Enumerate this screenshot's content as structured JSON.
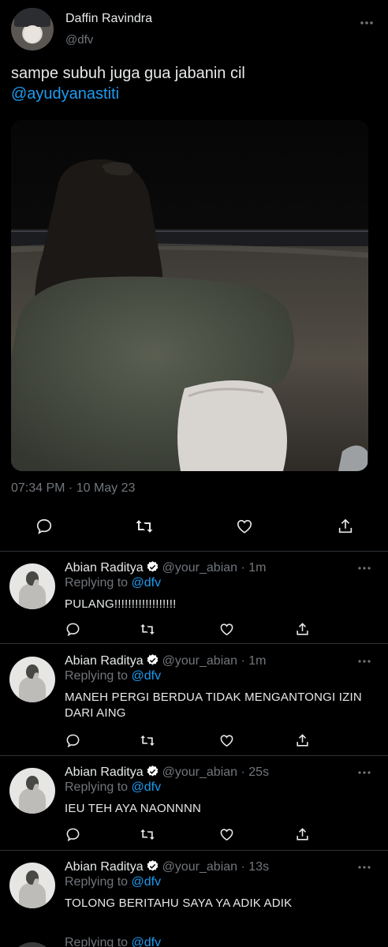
{
  "tweet": {
    "author_name": "Daffin Ravindra",
    "author_handle": "@dfv",
    "text_line": "sampe subuh juga gua jabanin cil",
    "mention": "@ayudyanastiti",
    "timestamp": "07:34 PM · 10 May 23"
  },
  "replies": [
    {
      "name": "Abian Raditya",
      "handle": "@your_abian",
      "age": "1m",
      "replying_label": "Replying to",
      "replying_to": "@dfv",
      "text": "PULANG!!!!!!!!!!!!!!!!!!"
    },
    {
      "name": "Abian Raditya",
      "handle": "@your_abian",
      "age": "1m",
      "replying_label": "Replying to",
      "replying_to": "@dfv",
      "text": "MANEH PERGI BERDUA TIDAK MENGANTONGI IZIN DARI AING"
    },
    {
      "name": "Abian Raditya",
      "handle": "@your_abian",
      "age": "25s",
      "replying_label": "Replying to",
      "replying_to": "@dfv",
      "text": "IEU TEH AYA NAONNNN"
    },
    {
      "name": "Abian Raditya",
      "handle": "@your_abian",
      "age": "13s",
      "replying_label": "Replying to",
      "replying_to": "@dfv",
      "text": "TOLONG BERITAHU SAYA YA ADIK ADIK"
    }
  ],
  "partial_next": {
    "replying_label": "Replying to",
    "replying_to": "@dfv"
  },
  "colors": {
    "background": "#000000",
    "text": "#e7e9ea",
    "muted": "#71767b",
    "link": "#1d9bf0",
    "verified": "#ffffff"
  }
}
